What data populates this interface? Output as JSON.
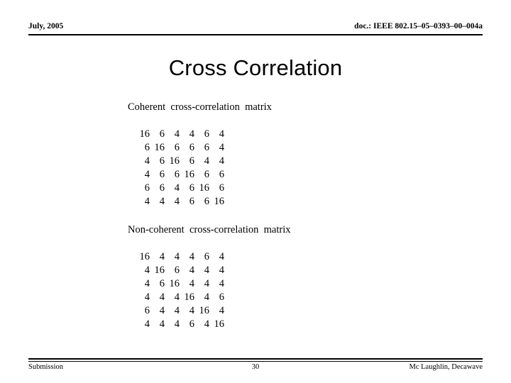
{
  "header": {
    "date": "July, 2005",
    "doc_id": "doc.: IEEE 802.15–05–0393–00–004a"
  },
  "title": "Cross Correlation",
  "body": {
    "coherent_caption": "Coherent  cross-correlation  matrix",
    "noncoherent_caption": "Non-coherent  cross-correlation  matrix",
    "coherent_matrix": [
      [
        "16",
        "6",
        "4",
        "4",
        "6",
        "4"
      ],
      [
        "6",
        "16",
        "6",
        "6",
        "6",
        "4"
      ],
      [
        "4",
        "6",
        "16",
        "6",
        "4",
        "4"
      ],
      [
        "4",
        "6",
        "6",
        "16",
        "6",
        "6"
      ],
      [
        "6",
        "6",
        "4",
        "6",
        "16",
        "6"
      ],
      [
        "4",
        "4",
        "4",
        "6",
        "6",
        "16"
      ]
    ],
    "noncoherent_matrix": [
      [
        "16",
        "4",
        "4",
        "4",
        "6",
        "4"
      ],
      [
        "4",
        "16",
        "6",
        "4",
        "4",
        "4"
      ],
      [
        "4",
        "6",
        "16",
        "4",
        "4",
        "4"
      ],
      [
        "4",
        "4",
        "4",
        "16",
        "4",
        "6"
      ],
      [
        "6",
        "4",
        "4",
        "4",
        "16",
        "4"
      ],
      [
        "4",
        "4",
        "4",
        "6",
        "4",
        "16"
      ]
    ]
  },
  "footer": {
    "left": "Submission",
    "page_number": "30",
    "right": "Mc Laughlin, Decawave"
  },
  "colors": {
    "text": "#000000",
    "background": "#ffffff",
    "rule": "#000000"
  }
}
